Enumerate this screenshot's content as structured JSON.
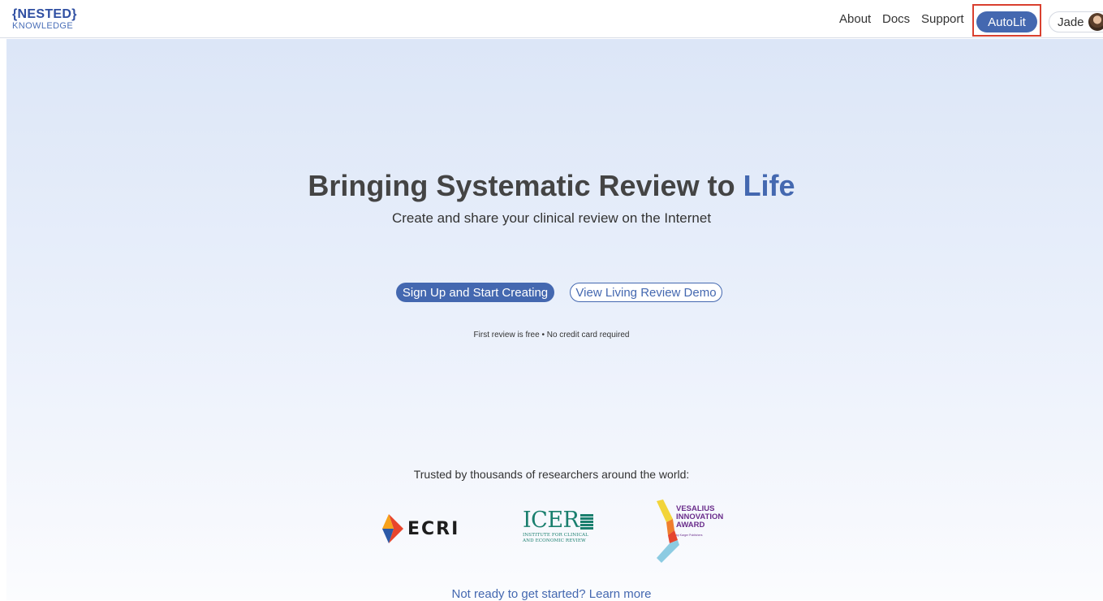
{
  "header": {
    "logo_top": "{NESTED}",
    "logo_bottom": "KNOWLEDGE",
    "nav": {
      "about": "About",
      "docs": "Docs",
      "support": "Support",
      "autolit": "AutoLit"
    },
    "user_name": "Jade"
  },
  "hero": {
    "title_main": "Bringing Systematic Review to ",
    "title_accent": "Life",
    "subtitle": "Create and share your clinical review on the Internet",
    "primary_button": "Sign Up and Start Creating",
    "secondary_button": "View Living Review Demo",
    "note": "First review is free • No credit card required"
  },
  "trust": {
    "heading": "Trusted by thousands of researchers around the world:",
    "logos": {
      "ecri": "ECRI",
      "icer_name": "ICER",
      "icer_sub_line1": "INSTITUTE FOR CLINICAL",
      "icer_sub_line2": "AND ECONOMIC REVIEW",
      "vesalius_line1": "VESALIUS",
      "vesalius_line2": "INNOVATION",
      "vesalius_line3": "AWARD",
      "vesalius_by": "by Karger Publishers"
    }
  },
  "footer_link": "Not ready to get started? Learn more",
  "colors": {
    "brand_blue": "#4468b0",
    "highlight_red": "#d9402f",
    "icer_green": "#1a7f6e",
    "vesalius_purple": "#6a2d8b"
  }
}
